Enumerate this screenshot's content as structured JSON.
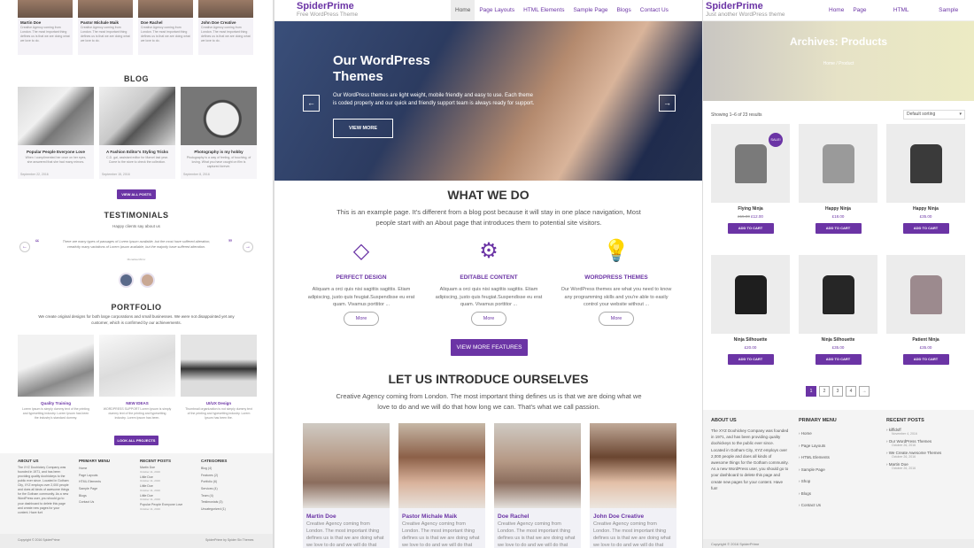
{
  "left": {
    "team": [
      {
        "name": "Martin Doe",
        "desc": "Creative Agency coming from London. The most important thing defines us is that we are doing what we love to do."
      },
      {
        "name": "Pastor Michale Maik",
        "desc": "Creative Agency coming from London. The most important thing defines us is that we are doing what we love to do."
      },
      {
        "name": "Doe Rachel",
        "desc": "Creative Agency coming from London. The most important thing defines us is that we are doing what we love to do."
      },
      {
        "name": "John Doe Creative",
        "desc": "Creative Agency coming from London. The most important thing defines us is that we are doing what we love to do."
      }
    ],
    "blog_heading": "BLOG",
    "blog": [
      {
        "title": "Popular People Everyone Love",
        "desc": "When I complimented her once on her eyes, she answered that she had many mirrors.",
        "date": "September 22, 2016"
      },
      {
        "title": "A Fashion Editor's Styling Tricks",
        "desc": "C.D. gal, assistant editor for Marvel last year. Come to the store to check the collection.",
        "date": "September 15, 2016"
      },
      {
        "title": "Photography is my hobby",
        "desc": "Photography is a way of feeling, of touching, of loving. What you have caught on film is captured forever.",
        "date": "September 8, 2016"
      }
    ],
    "view_all_posts": "VIEW ALL POSTS",
    "testimonials_heading": "TESTIMONIALS",
    "testimonials_sub": "Happy clients say about us",
    "testimonial_quote": "There are many types of passages of Lorem Ipsum available, but the most have suffered alteration, creativity many variations of Lorem Ipsum available, but the majority have suffered alteration.",
    "testimonial_author": "Monalisa Mirror",
    "portfolio_heading": "PORTFOLIO",
    "portfolio_sub": "We create original designs for both large corporations and small businesses. We were not disappointed yet any customer, which is confirmed by our achievements.",
    "portfolio": [
      {
        "title": "Quality Training",
        "desc": "Lorem Ipsum is simply dummy text of the printing and typesetting industry. Lorem Ipsum has been the industry's standard dummy."
      },
      {
        "title": "NEW IDEAS",
        "desc": "WORDPRESS SUPPORT Lorem Ipsum is simply dummy text of the printing and typesetting industry. Lorem Ipsum has been."
      },
      {
        "title": "UI/UX Design",
        "desc": "Thumbnail organization is not simply dummy text of the printing and typesetting industry. Lorem Ipsum has been the."
      }
    ],
    "look_all_projects": "LOOK ALL PROJECTS",
    "footer": {
      "about_title": "ABOUT US",
      "about_text": "The XYZ Doohickey Company was founded in 1971, and has been providing quality doohickeys to the public ever since. Located in Gotham City, XYZ employs over 2,000 people and does all kinds of awesome things for the Gotham community. As a new WordPress user, you should go to your dashboard to delete this page and create new pages for your content. Have fun!",
      "menu_title": "PRIMARY MENU",
      "menu_items": [
        "Home",
        "Page Layouts",
        "HTML Elements",
        "Sample Page",
        "Blogs",
        "Contact Us"
      ],
      "recent_title": "RECENT POSTS",
      "recent_items": [
        "Martin Doe",
        "Little Doe",
        "Little Doe",
        "Little Doe",
        "Popular People Everyone Love"
      ],
      "recent_dates": [
        "October 11, 2016",
        "October 11, 2016",
        "October 11, 2016",
        "October 11, 2016",
        "October 11, 2016"
      ],
      "cat_title": "CATEGORIES",
      "cat_items": [
        "Blog (4)",
        "Features (2)",
        "Portfolio (6)",
        "Services (4)",
        "Team (4)",
        "Testimonials (3)",
        "Uncategorized (1)"
      ]
    },
    "copyright": "Copyright © 2016 SpiderPrime",
    "theme_credit": "SpiderPrime by Spider Six Themes"
  },
  "center": {
    "logo": "SpiderPrime",
    "tagline": "Free WordPress Theme",
    "menu": [
      "Home",
      "Page Layouts",
      "HTML Elements",
      "Sample Page",
      "Blogs",
      "Contact Us"
    ],
    "hero_title": "Our WordPress Themes",
    "hero_text": "Our WordPress themes are light weight, mobile friendly and easy to use. Each theme is coded properly and our quick and friendly support team is always ready for support.",
    "hero_button": "VIEW MORE",
    "prev_arrow": "←",
    "next_arrow": "→",
    "what_title": "WHAT WE DO",
    "what_text": "This is an example page. It's different from a blog post because it will stay in one place navigation, Most people start with an About page that introduces them to potential site visitors.",
    "features": [
      {
        "icon": "diamond-icon",
        "glyph": "◇",
        "title": "PERFECT DESIGN",
        "desc": "Aliquam a orci quis nisi sagittis sagittis. Etiam adipiscing, justo quis feugiat.Suspendisse eu erat quam. Vivamus porttitor ..."
      },
      {
        "icon": "gear-icon",
        "glyph": "⚙",
        "title": "EDITABLE CONTENT",
        "desc": "Aliquam a orci quis nisi sagittis sagittis. Etiam adipiscing, justo quis feugiat.Suspendisse eu erat quam. Vivamus porttitor ..."
      },
      {
        "icon": "lightbulb-icon",
        "glyph": "💡",
        "title": "WORDPRESS THEMES",
        "desc": "Our WordPress themes are what you need to know any programming skills and you're able to easily control your website without ..."
      }
    ],
    "more_label": "More",
    "view_more_features": "VIEW MORE FEATURES",
    "intro_title": "LET US INTRODUCE OURSELVES",
    "intro_text": "Creative Agency coming from London. The most important thing defines us is that we are doing what we love to do and we will do that how long we can. That's what we call passion.",
    "team": [
      {
        "name": "Martin Doe",
        "desc": "Creative Agency coming from London. The most important thing defines us is that we are doing what we love to do and we will do that"
      },
      {
        "name": "Pastor Michale Maik",
        "desc": "Creative Agency coming from London. The most important thing defines us is that we are doing what we love to do and we will do that"
      },
      {
        "name": "Doe Rachel",
        "desc": "Creative Agency coming from London. The most important thing defines us is that we are doing what we love to do and we will do that"
      },
      {
        "name": "John Doe Creative",
        "desc": "Creative Agency coming from London. The most important thing defines us is that we are doing what we love to do and we will do that"
      }
    ]
  },
  "right": {
    "logo": "SpiderPrime",
    "tagline": "Just another WordPress theme",
    "menu": [
      "Home",
      "Page Layouts",
      "HTML Elements",
      "Sample Page"
    ],
    "archive_title": "Archives: Products",
    "breadcrumb": "Home / Product",
    "result_count": "Showing 1–6 of 23 results",
    "sorting": "Default sorting",
    "sale_badge": "SALE!",
    "products": [
      {
        "name": "Flying Ninja",
        "old_price": "£15.00",
        "price": "£12.00",
        "color": "#7a7a7a",
        "cart": "ADD TO CART"
      },
      {
        "name": "Happy Ninja",
        "old_price": "",
        "price": "£18.00",
        "color": "#9a9a9a",
        "cart": "ADD TO CART"
      },
      {
        "name": "Happy Ninja",
        "old_price": "",
        "price": "£35.00",
        "color": "#3a3a3a",
        "cart": "ADD TO CART"
      },
      {
        "name": "Ninja Silhouette",
        "old_price": "",
        "price": "£20.00",
        "color": "#1e1e1e",
        "cart": "ADD TO CART"
      },
      {
        "name": "Ninja Silhouette",
        "old_price": "",
        "price": "£35.00",
        "color": "#262626",
        "cart": "ADD TO CART"
      },
      {
        "name": "Patient Ninja",
        "old_price": "",
        "price": "£35.00",
        "color": "#9c8a8e",
        "cart": "ADD TO CART"
      }
    ],
    "pagination": [
      "1",
      "2",
      "3",
      "4",
      "→"
    ],
    "footer": {
      "about_title": "ABOUT US",
      "about_text": "The XYZ Doohickey Company was founded in 1971, and has been providing quality doohickeys to the public ever since. Located in Gotham City, XYZ employs over 2,000 people and does all kinds of awesome things for the Gotham community. As a new WordPress user, you should go to your dashboard to delete this page and create new pages for your content. Have fun!",
      "menu_title": "PRIMARY MENU",
      "menu_items": [
        "Home",
        "Page Layouts",
        "HTML Elements",
        "Sample Page",
        "Shop",
        "Blogs",
        "Contact Us"
      ],
      "recent_title": "RECENT POSTS",
      "recent_items": [
        "kiffldsff",
        "Our WordPress Themes",
        "We Create Awesome Themes",
        "Martin Doe"
      ],
      "recent_dates": [
        "November 4, 2016",
        "October 26, 2016",
        "October 26, 2016",
        "October 26, 2016"
      ]
    },
    "copyright": "Copyright © 2016 SpiderPrime"
  },
  "colors": {
    "accent": "#6b34a5",
    "footer_bg": "#f4f4f4"
  }
}
